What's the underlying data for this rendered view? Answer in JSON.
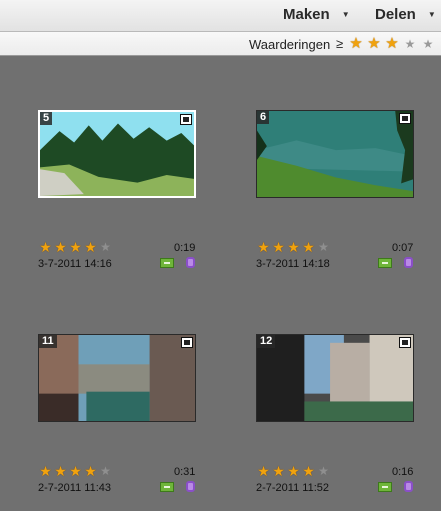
{
  "header": {
    "maken_label": "Maken",
    "delen_label": "Delen"
  },
  "filter": {
    "label": "Waarderingen",
    "operator": "≥",
    "stars_on": 3,
    "stars_total": 5
  },
  "items": [
    {
      "index": "5",
      "rating": 4,
      "duration": "0:19",
      "date": "3-7-2011 14:16",
      "type": "video"
    },
    {
      "index": "6",
      "rating": 4,
      "duration": "0:07",
      "date": "3-7-2011 14:18",
      "type": "video"
    },
    {
      "index": "11",
      "rating": 4,
      "duration": "0:31",
      "date": "2-7-2011 11:43",
      "type": "video"
    },
    {
      "index": "12",
      "rating": 4,
      "duration": "0:16",
      "date": "2-7-2011 11:52",
      "type": "video"
    }
  ],
  "colors": {
    "background": "#707070",
    "star_on": "#f0a20e",
    "star_off": "#8f8f8f",
    "badge_green": "#6fb53a",
    "badge_purple": "#8a4fc8"
  }
}
